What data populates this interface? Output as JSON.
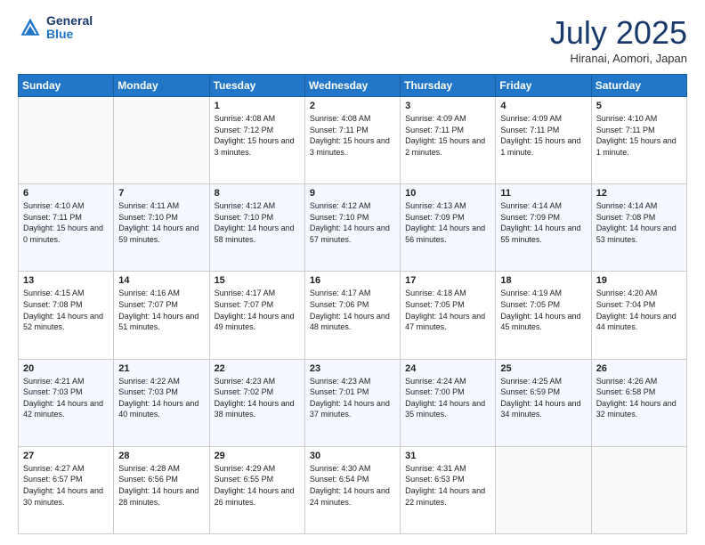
{
  "logo": {
    "line1": "General",
    "line2": "Blue"
  },
  "title": "July 2025",
  "location": "Hiranai, Aomori, Japan",
  "weekdays": [
    "Sunday",
    "Monday",
    "Tuesday",
    "Wednesday",
    "Thursday",
    "Friday",
    "Saturday"
  ],
  "weeks": [
    [
      {
        "day": "",
        "info": ""
      },
      {
        "day": "",
        "info": ""
      },
      {
        "day": "1",
        "info": "Sunrise: 4:08 AM\nSunset: 7:12 PM\nDaylight: 15 hours and 3 minutes."
      },
      {
        "day": "2",
        "info": "Sunrise: 4:08 AM\nSunset: 7:11 PM\nDaylight: 15 hours and 3 minutes."
      },
      {
        "day": "3",
        "info": "Sunrise: 4:09 AM\nSunset: 7:11 PM\nDaylight: 15 hours and 2 minutes."
      },
      {
        "day": "4",
        "info": "Sunrise: 4:09 AM\nSunset: 7:11 PM\nDaylight: 15 hours and 1 minute."
      },
      {
        "day": "5",
        "info": "Sunrise: 4:10 AM\nSunset: 7:11 PM\nDaylight: 15 hours and 1 minute."
      }
    ],
    [
      {
        "day": "6",
        "info": "Sunrise: 4:10 AM\nSunset: 7:11 PM\nDaylight: 15 hours and 0 minutes."
      },
      {
        "day": "7",
        "info": "Sunrise: 4:11 AM\nSunset: 7:10 PM\nDaylight: 14 hours and 59 minutes."
      },
      {
        "day": "8",
        "info": "Sunrise: 4:12 AM\nSunset: 7:10 PM\nDaylight: 14 hours and 58 minutes."
      },
      {
        "day": "9",
        "info": "Sunrise: 4:12 AM\nSunset: 7:10 PM\nDaylight: 14 hours and 57 minutes."
      },
      {
        "day": "10",
        "info": "Sunrise: 4:13 AM\nSunset: 7:09 PM\nDaylight: 14 hours and 56 minutes."
      },
      {
        "day": "11",
        "info": "Sunrise: 4:14 AM\nSunset: 7:09 PM\nDaylight: 14 hours and 55 minutes."
      },
      {
        "day": "12",
        "info": "Sunrise: 4:14 AM\nSunset: 7:08 PM\nDaylight: 14 hours and 53 minutes."
      }
    ],
    [
      {
        "day": "13",
        "info": "Sunrise: 4:15 AM\nSunset: 7:08 PM\nDaylight: 14 hours and 52 minutes."
      },
      {
        "day": "14",
        "info": "Sunrise: 4:16 AM\nSunset: 7:07 PM\nDaylight: 14 hours and 51 minutes."
      },
      {
        "day": "15",
        "info": "Sunrise: 4:17 AM\nSunset: 7:07 PM\nDaylight: 14 hours and 49 minutes."
      },
      {
        "day": "16",
        "info": "Sunrise: 4:17 AM\nSunset: 7:06 PM\nDaylight: 14 hours and 48 minutes."
      },
      {
        "day": "17",
        "info": "Sunrise: 4:18 AM\nSunset: 7:05 PM\nDaylight: 14 hours and 47 minutes."
      },
      {
        "day": "18",
        "info": "Sunrise: 4:19 AM\nSunset: 7:05 PM\nDaylight: 14 hours and 45 minutes."
      },
      {
        "day": "19",
        "info": "Sunrise: 4:20 AM\nSunset: 7:04 PM\nDaylight: 14 hours and 44 minutes."
      }
    ],
    [
      {
        "day": "20",
        "info": "Sunrise: 4:21 AM\nSunset: 7:03 PM\nDaylight: 14 hours and 42 minutes."
      },
      {
        "day": "21",
        "info": "Sunrise: 4:22 AM\nSunset: 7:03 PM\nDaylight: 14 hours and 40 minutes."
      },
      {
        "day": "22",
        "info": "Sunrise: 4:23 AM\nSunset: 7:02 PM\nDaylight: 14 hours and 38 minutes."
      },
      {
        "day": "23",
        "info": "Sunrise: 4:23 AM\nSunset: 7:01 PM\nDaylight: 14 hours and 37 minutes."
      },
      {
        "day": "24",
        "info": "Sunrise: 4:24 AM\nSunset: 7:00 PM\nDaylight: 14 hours and 35 minutes."
      },
      {
        "day": "25",
        "info": "Sunrise: 4:25 AM\nSunset: 6:59 PM\nDaylight: 14 hours and 34 minutes."
      },
      {
        "day": "26",
        "info": "Sunrise: 4:26 AM\nSunset: 6:58 PM\nDaylight: 14 hours and 32 minutes."
      }
    ],
    [
      {
        "day": "27",
        "info": "Sunrise: 4:27 AM\nSunset: 6:57 PM\nDaylight: 14 hours and 30 minutes."
      },
      {
        "day": "28",
        "info": "Sunrise: 4:28 AM\nSunset: 6:56 PM\nDaylight: 14 hours and 28 minutes."
      },
      {
        "day": "29",
        "info": "Sunrise: 4:29 AM\nSunset: 6:55 PM\nDaylight: 14 hours and 26 minutes."
      },
      {
        "day": "30",
        "info": "Sunrise: 4:30 AM\nSunset: 6:54 PM\nDaylight: 14 hours and 24 minutes."
      },
      {
        "day": "31",
        "info": "Sunrise: 4:31 AM\nSunset: 6:53 PM\nDaylight: 14 hours and 22 minutes."
      },
      {
        "day": "",
        "info": ""
      },
      {
        "day": "",
        "info": ""
      }
    ]
  ]
}
